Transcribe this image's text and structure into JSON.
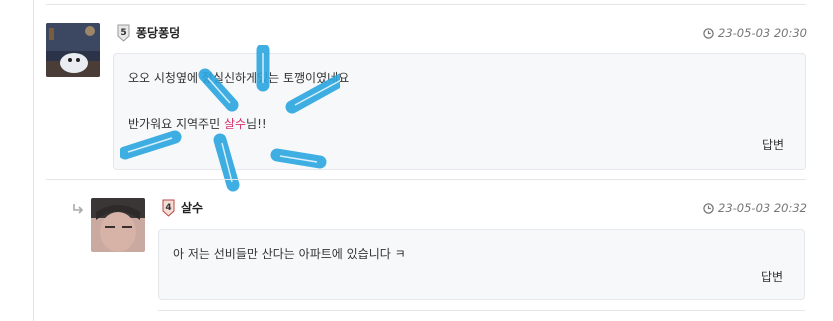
{
  "comments": [
    {
      "author": "퐁당퐁덩",
      "level": "5",
      "timestamp": "23-05-03 20:30",
      "body_line1": "오오 시청옆에 젊실신하게있는 토깽이였네요",
      "body_line2_prefix": "반가워요 지역주민 ",
      "mention": "살수",
      "body_line2_suffix": "님!!",
      "reply_label": "답변"
    },
    {
      "author": "살수",
      "level": "4",
      "timestamp": "23-05-03 20:32",
      "body_line1": "아 저는 선비들만 산다는 아파트에 있습니다 ㅋ",
      "reply_label": "답변"
    }
  ],
  "colors": {
    "mention": "#d6336c",
    "scribble": "#2aa6e0",
    "bubble_bg": "#f7f8fa"
  },
  "icons": [
    "clock-icon",
    "reply-arrow-icon",
    "level-badge-icon"
  ]
}
